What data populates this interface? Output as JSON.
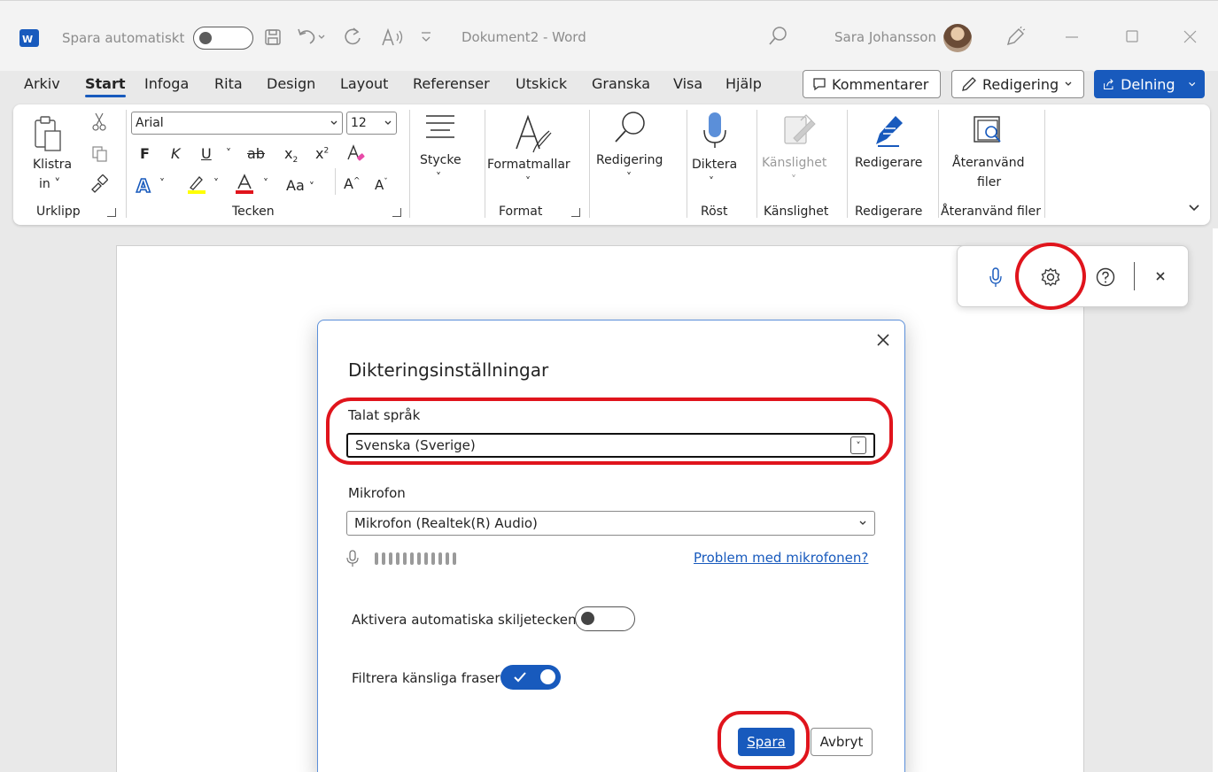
{
  "titlebar": {
    "autosave_label": "Spara automatiskt",
    "doc_title": "Dokument2  -  Word",
    "user_name": "Sara Johansson"
  },
  "menu": {
    "items": [
      "Arkiv",
      "Start",
      "Infoga",
      "Rita",
      "Design",
      "Layout",
      "Referenser",
      "Utskick",
      "Granska",
      "Visa",
      "Hjälp"
    ],
    "comments": "Kommentarer",
    "editing": "Redigering",
    "share": "Delning"
  },
  "ribbon": {
    "paste_label": "Klistra",
    "paste_label2": "in",
    "font_name": "Arial",
    "font_size": "12",
    "bold": "F",
    "italic": "K",
    "underline": "U",
    "strike": "ab",
    "change_case": "Aa",
    "paragraph": "Stycke",
    "styles": "Formatmallar",
    "editing": "Redigering",
    "dictate": "Diktera",
    "sensitivity": "Känslighet",
    "editor": "Redigerare",
    "reuse_files": "Återanvänd",
    "reuse_files2": "filer",
    "groups": {
      "clipboard": "Urklipp",
      "font": "Tecken",
      "format": "Format",
      "voice": "Röst",
      "sensitivity": "Känslighet",
      "editor": "Redigerare",
      "reuse": "Återanvänd filer"
    }
  },
  "dictation": {
    "dialog_title": "Dikteringsinställningar",
    "language_label": "Talat språk",
    "language_value": "Svenska (Sverige)",
    "mic_label": "Mikrofon",
    "mic_value": "Mikrofon (Realtek(R) Audio)",
    "mic_problem_link": "Problem med mikrofonen?",
    "auto_punct_label": "Aktivera automatiska skiljetecken",
    "auto_punct_on": false,
    "filter_label": "Filtrera känsliga fraser",
    "filter_on": true,
    "save_button": "Spara",
    "cancel_button": "Avbryt"
  },
  "colors": {
    "accent": "#185abd",
    "highlight_ring": "#e0141c"
  }
}
